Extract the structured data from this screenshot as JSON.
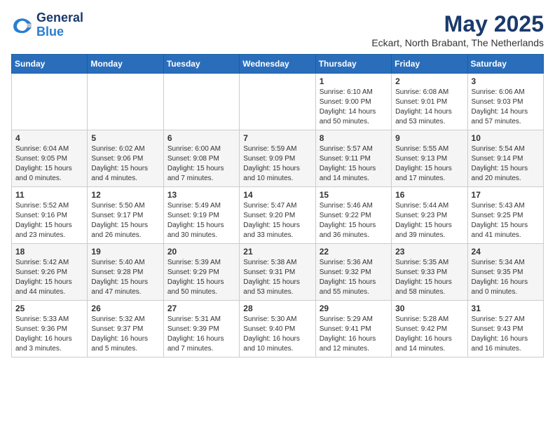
{
  "header": {
    "logo_line1": "General",
    "logo_line2": "Blue",
    "month_title": "May 2025",
    "location": "Eckart, North Brabant, The Netherlands"
  },
  "weekdays": [
    "Sunday",
    "Monday",
    "Tuesday",
    "Wednesday",
    "Thursday",
    "Friday",
    "Saturday"
  ],
  "weeks": [
    [
      {
        "day": "",
        "info": ""
      },
      {
        "day": "",
        "info": ""
      },
      {
        "day": "",
        "info": ""
      },
      {
        "day": "",
        "info": ""
      },
      {
        "day": "1",
        "info": "Sunrise: 6:10 AM\nSunset: 9:00 PM\nDaylight: 14 hours\nand 50 minutes."
      },
      {
        "day": "2",
        "info": "Sunrise: 6:08 AM\nSunset: 9:01 PM\nDaylight: 14 hours\nand 53 minutes."
      },
      {
        "day": "3",
        "info": "Sunrise: 6:06 AM\nSunset: 9:03 PM\nDaylight: 14 hours\nand 57 minutes."
      }
    ],
    [
      {
        "day": "4",
        "info": "Sunrise: 6:04 AM\nSunset: 9:05 PM\nDaylight: 15 hours\nand 0 minutes."
      },
      {
        "day": "5",
        "info": "Sunrise: 6:02 AM\nSunset: 9:06 PM\nDaylight: 15 hours\nand 4 minutes."
      },
      {
        "day": "6",
        "info": "Sunrise: 6:00 AM\nSunset: 9:08 PM\nDaylight: 15 hours\nand 7 minutes."
      },
      {
        "day": "7",
        "info": "Sunrise: 5:59 AM\nSunset: 9:09 PM\nDaylight: 15 hours\nand 10 minutes."
      },
      {
        "day": "8",
        "info": "Sunrise: 5:57 AM\nSunset: 9:11 PM\nDaylight: 15 hours\nand 14 minutes."
      },
      {
        "day": "9",
        "info": "Sunrise: 5:55 AM\nSunset: 9:13 PM\nDaylight: 15 hours\nand 17 minutes."
      },
      {
        "day": "10",
        "info": "Sunrise: 5:54 AM\nSunset: 9:14 PM\nDaylight: 15 hours\nand 20 minutes."
      }
    ],
    [
      {
        "day": "11",
        "info": "Sunrise: 5:52 AM\nSunset: 9:16 PM\nDaylight: 15 hours\nand 23 minutes."
      },
      {
        "day": "12",
        "info": "Sunrise: 5:50 AM\nSunset: 9:17 PM\nDaylight: 15 hours\nand 26 minutes."
      },
      {
        "day": "13",
        "info": "Sunrise: 5:49 AM\nSunset: 9:19 PM\nDaylight: 15 hours\nand 30 minutes."
      },
      {
        "day": "14",
        "info": "Sunrise: 5:47 AM\nSunset: 9:20 PM\nDaylight: 15 hours\nand 33 minutes."
      },
      {
        "day": "15",
        "info": "Sunrise: 5:46 AM\nSunset: 9:22 PM\nDaylight: 15 hours\nand 36 minutes."
      },
      {
        "day": "16",
        "info": "Sunrise: 5:44 AM\nSunset: 9:23 PM\nDaylight: 15 hours\nand 39 minutes."
      },
      {
        "day": "17",
        "info": "Sunrise: 5:43 AM\nSunset: 9:25 PM\nDaylight: 15 hours\nand 41 minutes."
      }
    ],
    [
      {
        "day": "18",
        "info": "Sunrise: 5:42 AM\nSunset: 9:26 PM\nDaylight: 15 hours\nand 44 minutes."
      },
      {
        "day": "19",
        "info": "Sunrise: 5:40 AM\nSunset: 9:28 PM\nDaylight: 15 hours\nand 47 minutes."
      },
      {
        "day": "20",
        "info": "Sunrise: 5:39 AM\nSunset: 9:29 PM\nDaylight: 15 hours\nand 50 minutes."
      },
      {
        "day": "21",
        "info": "Sunrise: 5:38 AM\nSunset: 9:31 PM\nDaylight: 15 hours\nand 53 minutes."
      },
      {
        "day": "22",
        "info": "Sunrise: 5:36 AM\nSunset: 9:32 PM\nDaylight: 15 hours\nand 55 minutes."
      },
      {
        "day": "23",
        "info": "Sunrise: 5:35 AM\nSunset: 9:33 PM\nDaylight: 15 hours\nand 58 minutes."
      },
      {
        "day": "24",
        "info": "Sunrise: 5:34 AM\nSunset: 9:35 PM\nDaylight: 16 hours\nand 0 minutes."
      }
    ],
    [
      {
        "day": "25",
        "info": "Sunrise: 5:33 AM\nSunset: 9:36 PM\nDaylight: 16 hours\nand 3 minutes."
      },
      {
        "day": "26",
        "info": "Sunrise: 5:32 AM\nSunset: 9:37 PM\nDaylight: 16 hours\nand 5 minutes."
      },
      {
        "day": "27",
        "info": "Sunrise: 5:31 AM\nSunset: 9:39 PM\nDaylight: 16 hours\nand 7 minutes."
      },
      {
        "day": "28",
        "info": "Sunrise: 5:30 AM\nSunset: 9:40 PM\nDaylight: 16 hours\nand 10 minutes."
      },
      {
        "day": "29",
        "info": "Sunrise: 5:29 AM\nSunset: 9:41 PM\nDaylight: 16 hours\nand 12 minutes."
      },
      {
        "day": "30",
        "info": "Sunrise: 5:28 AM\nSunset: 9:42 PM\nDaylight: 16 hours\nand 14 minutes."
      },
      {
        "day": "31",
        "info": "Sunrise: 5:27 AM\nSunset: 9:43 PM\nDaylight: 16 hours\nand 16 minutes."
      }
    ]
  ]
}
